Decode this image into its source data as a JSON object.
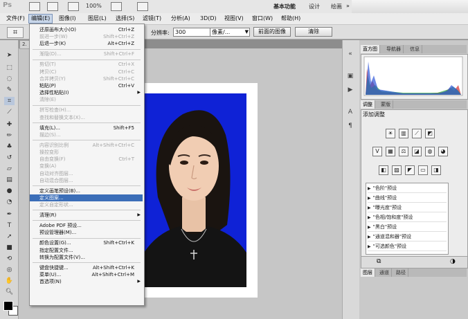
{
  "titlebar": {
    "app_logo": "Ps",
    "zoom": "100%",
    "workspaces": {
      "basic": "基本功能",
      "design": "设计",
      "paint": "绘画"
    },
    "overflow": "»"
  },
  "menubar": [
    "文件(F)",
    "编辑(E)",
    "图像(I)",
    "图层(L)",
    "选择(S)",
    "滤镜(T)",
    "分析(A)",
    "3D(D)",
    "视图(V)",
    "窗口(W)",
    "帮助(H)"
  ],
  "options": {
    "resolution_label": "分辨率:",
    "resolution_value": "300",
    "unit_value": "像素/...",
    "front_image_button": "前面的图像",
    "clear_button": "清除"
  },
  "document": {
    "tab_label": "2."
  },
  "edit_menu": {
    "groups": [
      [
        {
          "label": "还原画布大小(O)",
          "shortcut": "Ctrl+Z",
          "disabled": false
        },
        {
          "label": "前进一步(W)",
          "shortcut": "Shift+Ctrl+Z",
          "disabled": true
        },
        {
          "label": "后退一步(K)",
          "shortcut": "Alt+Ctrl+Z",
          "disabled": false
        }
      ],
      [
        {
          "label": "渐隐(D)...",
          "shortcut": "Shift+Ctrl+F",
          "disabled": true
        }
      ],
      [
        {
          "label": "剪切(T)",
          "shortcut": "Ctrl+X",
          "disabled": true
        },
        {
          "label": "拷贝(C)",
          "shortcut": "Ctrl+C",
          "disabled": true
        },
        {
          "label": "合并拷贝(Y)",
          "shortcut": "Shift+Ctrl+C",
          "disabled": true
        },
        {
          "label": "粘贴(P)",
          "shortcut": "Ctrl+V",
          "disabled": false
        },
        {
          "label": "选择性粘贴(I)",
          "shortcut": "",
          "disabled": false,
          "submenu": true
        },
        {
          "label": "清除(E)",
          "shortcut": "",
          "disabled": true
        }
      ],
      [
        {
          "label": "拼写检查(H)...",
          "shortcut": "",
          "disabled": true
        },
        {
          "label": "查找和替换文本(X)...",
          "shortcut": "",
          "disabled": true
        }
      ],
      [
        {
          "label": "填充(L)...",
          "shortcut": "Shift+F5",
          "disabled": false
        },
        {
          "label": "描边(S)...",
          "shortcut": "",
          "disabled": true
        }
      ],
      [
        {
          "label": "内容识别比例",
          "shortcut": "Alt+Shift+Ctrl+C",
          "disabled": true
        },
        {
          "label": "操控变形",
          "shortcut": "",
          "disabled": true
        },
        {
          "label": "自由变换(F)",
          "shortcut": "Ctrl+T",
          "disabled": true
        },
        {
          "label": "变换(A)",
          "shortcut": "",
          "disabled": true
        },
        {
          "label": "自动对齐图层...",
          "shortcut": "",
          "disabled": true
        },
        {
          "label": "自动混合图层...",
          "shortcut": "",
          "disabled": true
        }
      ],
      [
        {
          "label": "定义画笔预设(B)...",
          "shortcut": "",
          "disabled": false
        },
        {
          "label": "定义图案...",
          "shortcut": "",
          "disabled": false,
          "highlighted": true
        },
        {
          "label": "定义自定形状...",
          "shortcut": "",
          "disabled": true
        }
      ],
      [
        {
          "label": "清理(R)",
          "shortcut": "",
          "disabled": false,
          "submenu": true
        }
      ],
      [
        {
          "label": "Adobe PDF 预设...",
          "shortcut": "",
          "disabled": false
        },
        {
          "label": "预设管理器(M)...",
          "shortcut": "",
          "disabled": false
        }
      ],
      [
        {
          "label": "颜色设置(G)...",
          "shortcut": "Shift+Ctrl+K",
          "disabled": false
        },
        {
          "label": "指定配置文件...",
          "shortcut": "",
          "disabled": false
        },
        {
          "label": "转换为配置文件(V)...",
          "shortcut": "",
          "disabled": false
        }
      ],
      [
        {
          "label": "键盘快捷键...",
          "shortcut": "Alt+Shift+Ctrl+K",
          "disabled": false
        },
        {
          "label": "菜单(U)...",
          "shortcut": "Alt+Shift+Ctrl+M",
          "disabled": false
        },
        {
          "label": "首选项(N)",
          "shortcut": "",
          "disabled": false,
          "submenu": true
        }
      ]
    ]
  },
  "panels": {
    "top_tabs": [
      "直方图",
      "导航器",
      "信息"
    ],
    "mid_tabs": [
      "调整",
      "蒙版"
    ],
    "adjust_title": "添加调整",
    "presets": [
      "\"色阶\"预设",
      "\"曲线\"预设",
      "\"曝光度\"预设",
      "\"色相/饱和度\"预设",
      "\"黑白\"预设",
      "\"通道混和器\"预设",
      "\"可选颜色\"预设"
    ],
    "bottom_tabs": [
      "图层",
      "通道",
      "路径"
    ]
  },
  "colors": {
    "photo_bg": "#0f22d6",
    "menu_highlight": "#3b6eb8"
  }
}
